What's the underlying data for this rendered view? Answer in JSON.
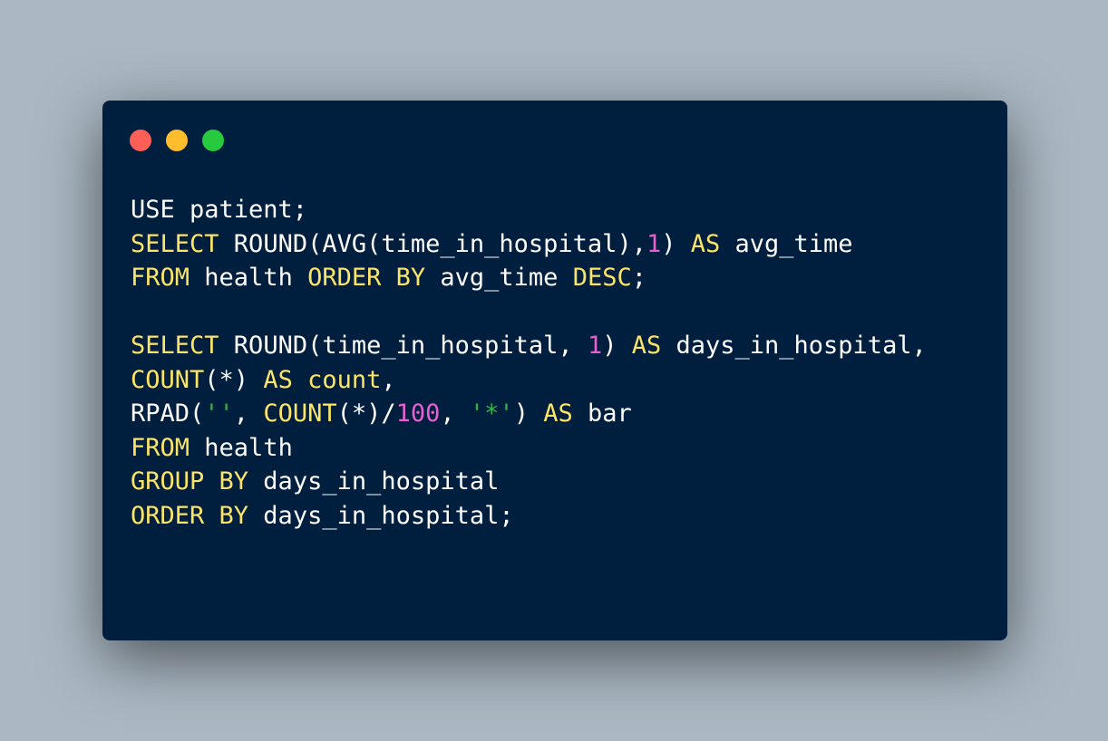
{
  "window": {
    "buttons": {
      "close_color": "#ff5f56",
      "minimize_color": "#ffbd2e",
      "zoom_color": "#27c93f"
    }
  },
  "colors": {
    "background": "#abb8c3",
    "editor": "#001f3f",
    "keyword": "#fce566",
    "number": "#e85fd0",
    "string": "#35b24a",
    "text": "#ffffff"
  },
  "code": {
    "lines": [
      [
        {
          "text": "USE patient;",
          "cls": "pl"
        }
      ],
      [
        {
          "text": "SELECT",
          "cls": "kw"
        },
        {
          "text": " ROUND(AVG(time_in_hospital),",
          "cls": "pl"
        },
        {
          "text": "1",
          "cls": "num"
        },
        {
          "text": ") ",
          "cls": "pl"
        },
        {
          "text": "AS",
          "cls": "kw"
        },
        {
          "text": " avg_time",
          "cls": "pl"
        }
      ],
      [
        {
          "text": "FROM",
          "cls": "kw"
        },
        {
          "text": " health ",
          "cls": "pl"
        },
        {
          "text": "ORDER BY",
          "cls": "kw"
        },
        {
          "text": " avg_time ",
          "cls": "pl"
        },
        {
          "text": "DESC",
          "cls": "kw"
        },
        {
          "text": ";",
          "cls": "pl"
        }
      ],
      [],
      [
        {
          "text": "SELECT",
          "cls": "kw"
        },
        {
          "text": " ROUND(time_in_hospital, ",
          "cls": "pl"
        },
        {
          "text": "1",
          "cls": "num"
        },
        {
          "text": ") ",
          "cls": "pl"
        },
        {
          "text": "AS",
          "cls": "kw"
        },
        {
          "text": " days_in_hospital,",
          "cls": "pl"
        }
      ],
      [
        {
          "text": "COUNT",
          "cls": "kw"
        },
        {
          "text": "(*) ",
          "cls": "pl"
        },
        {
          "text": "AS",
          "cls": "kw"
        },
        {
          "text": " ",
          "cls": "pl"
        },
        {
          "text": "count",
          "cls": "kw"
        },
        {
          "text": ",",
          "cls": "pl"
        }
      ],
      [
        {
          "text": "RPAD(",
          "cls": "pl"
        },
        {
          "text": "''",
          "cls": "str"
        },
        {
          "text": ", ",
          "cls": "pl"
        },
        {
          "text": "COUNT",
          "cls": "kw"
        },
        {
          "text": "(*)/",
          "cls": "pl"
        },
        {
          "text": "100",
          "cls": "num"
        },
        {
          "text": ", ",
          "cls": "pl"
        },
        {
          "text": "'*'",
          "cls": "str"
        },
        {
          "text": ") ",
          "cls": "pl"
        },
        {
          "text": "AS",
          "cls": "kw"
        },
        {
          "text": " bar",
          "cls": "pl"
        }
      ],
      [
        {
          "text": "FROM",
          "cls": "kw"
        },
        {
          "text": " health",
          "cls": "pl"
        }
      ],
      [
        {
          "text": "GROUP BY",
          "cls": "kw"
        },
        {
          "text": " days_in_hospital",
          "cls": "pl"
        }
      ],
      [
        {
          "text": "ORDER BY",
          "cls": "kw"
        },
        {
          "text": " days_in_hospital;",
          "cls": "pl"
        }
      ]
    ]
  }
}
